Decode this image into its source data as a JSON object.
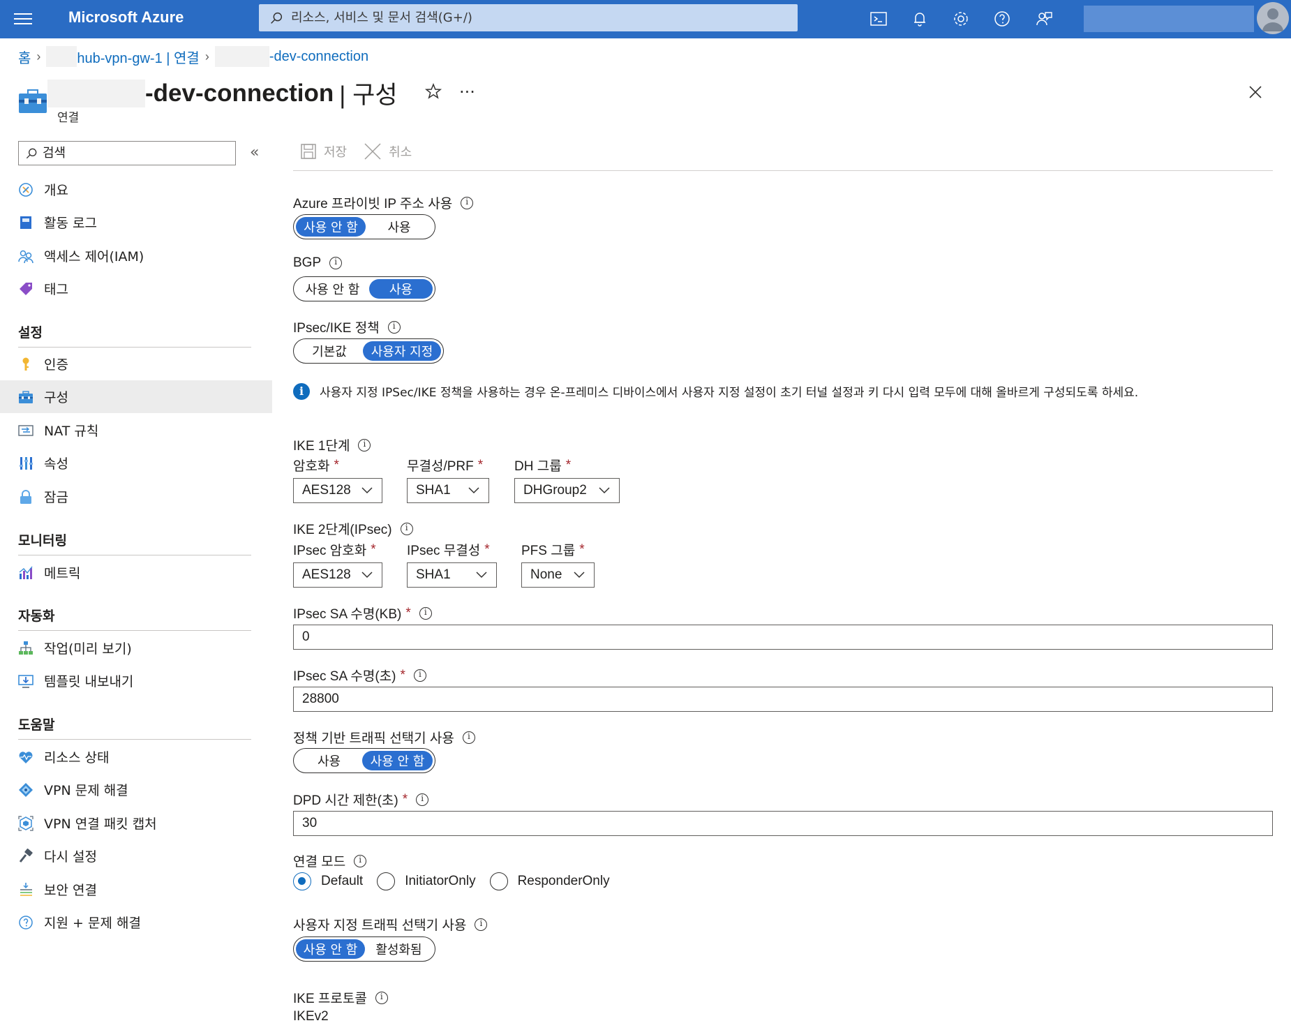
{
  "topbar": {
    "brand": "Microsoft Azure",
    "search_placeholder": "리소스, 서비스 및 문서 검색(G+/)",
    "icons": [
      "cloud-shell-icon",
      "bell-icon",
      "gear-icon",
      "help-icon",
      "feedback-icon"
    ]
  },
  "breadcrumb": {
    "home": "홈",
    "gateway": "hub-vpn-gw-1 | 연결",
    "connection": "-dev-connection"
  },
  "header": {
    "title": "-dev-connection",
    "title_rest": "| 구성",
    "subtitle": "연결"
  },
  "sidebar": {
    "search_placeholder": "검색",
    "items_top": [
      {
        "label": "개요",
        "icon": "overview-icon"
      },
      {
        "label": "활동 로그",
        "icon": "activity-log-icon"
      },
      {
        "label": "액세스 제어(IAM)",
        "icon": "iam-icon"
      },
      {
        "label": "태그",
        "icon": "tag-icon"
      }
    ],
    "section_settings": "설정",
    "items_settings": [
      {
        "label": "인증",
        "icon": "key-icon"
      },
      {
        "label": "구성",
        "icon": "configuration-icon"
      },
      {
        "label": "NAT 규칙",
        "icon": "nat-icon"
      },
      {
        "label": "속성",
        "icon": "properties-icon"
      },
      {
        "label": "잠금",
        "icon": "lock-icon"
      }
    ],
    "section_monitoring": "모니터링",
    "items_monitoring": [
      {
        "label": "메트릭",
        "icon": "metrics-icon"
      }
    ],
    "section_automation": "자동화",
    "items_automation": [
      {
        "label": "작업(미리 보기)",
        "icon": "tasks-icon"
      },
      {
        "label": "템플릿 내보내기",
        "icon": "export-template-icon"
      }
    ],
    "section_help": "도움말",
    "items_help": [
      {
        "label": "리소스 상태",
        "icon": "resource-health-icon"
      },
      {
        "label": "VPN 문제 해결",
        "icon": "vpn-troubleshoot-icon"
      },
      {
        "label": "VPN 연결 패킷 캡처",
        "icon": "packet-capture-icon"
      },
      {
        "label": "다시 설정",
        "icon": "reset-icon"
      },
      {
        "label": "보안 연결",
        "icon": "secure-connection-icon"
      },
      {
        "label": "지원 + 문제 해결",
        "icon": "support-icon"
      }
    ]
  },
  "toolbar": {
    "save_label": "저장",
    "cancel_label": "취소"
  },
  "form": {
    "private_ip": {
      "label": "Azure 프라이빗 IP 주소 사용",
      "options": [
        "사용 안 함",
        "사용"
      ],
      "selected": 0
    },
    "bgp": {
      "label": "BGP",
      "options": [
        "사용 안 함",
        "사용"
      ],
      "selected": 1
    },
    "ipsec_policy": {
      "label": "IPsec/IKE 정책",
      "options": [
        "기본값",
        "사용자 지정"
      ],
      "selected": 1
    },
    "info_message": "사용자 지정 IPSec/IKE 정책을 사용하는 경우 온-프레미스 디바이스에서 사용자 지정 설정이 초기 터널 설정과 키 다시 입력 모두에 대해 올바르게 구성되도록 하세요.",
    "ike1": {
      "label": "IKE 1단계",
      "encryption_label": "암호화",
      "encryption_value": "AES128",
      "integrity_label": "무결성/PRF",
      "integrity_value": "SHA1",
      "dh_label": "DH 그룹",
      "dh_value": "DHGroup2"
    },
    "ike2": {
      "label": "IKE 2단계(IPsec)",
      "encryption_label": "IPsec 암호화",
      "encryption_value": "AES128",
      "integrity_label": "IPsec 무결성",
      "integrity_value": "SHA1",
      "pfs_label": "PFS 그룹",
      "pfs_value": "None"
    },
    "sa_kb": {
      "label": "IPsec SA 수명(KB)",
      "value": "0"
    },
    "sa_sec": {
      "label": "IPsec SA 수명(초)",
      "value": "28800"
    },
    "policy_selector": {
      "label": "정책 기반 트래픽 선택기 사용",
      "options": [
        "사용",
        "사용 안 함"
      ],
      "selected": 1
    },
    "dpd": {
      "label": "DPD 시간 제한(초)",
      "value": "30"
    },
    "connection_mode": {
      "label": "연결 모드",
      "options": [
        "Default",
        "InitiatorOnly",
        "ResponderOnly"
      ],
      "selected": 0
    },
    "custom_selector": {
      "label": "사용자 지정 트래픽 선택기 사용",
      "options": [
        "사용 안 함",
        "활성화됨"
      ],
      "selected": 0
    },
    "ike_protocol": {
      "label": "IKE 프로토콜",
      "value": "IKEv2"
    }
  },
  "colors": {
    "topbar": "#2a6cc4",
    "accent": "#2b6fd0",
    "link": "#0f6cbd",
    "required": "#a4262c"
  }
}
